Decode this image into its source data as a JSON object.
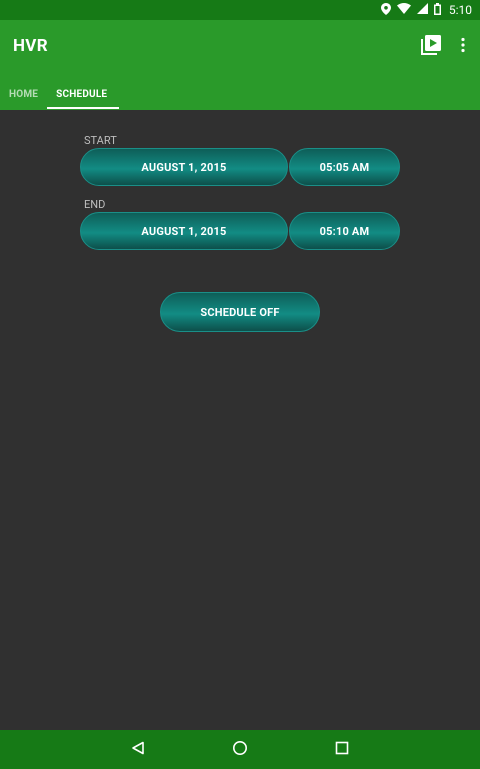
{
  "status_bar": {
    "time": "5:10",
    "icons": [
      "location-icon",
      "wifi-icon",
      "signal-icon",
      "battery-icon"
    ]
  },
  "app_bar": {
    "title": "HVR",
    "actions": [
      "video-library-icon",
      "overflow-menu-icon"
    ]
  },
  "tabs": [
    {
      "label": "HOME",
      "active": false
    },
    {
      "label": "SCHEDULE",
      "active": true
    }
  ],
  "schedule": {
    "start": {
      "label": "START",
      "date": "AUGUST 1, 2015",
      "time": "05:05 AM"
    },
    "end": {
      "label": "END",
      "date": "AUGUST 1, 2015",
      "time": "05:10 AM"
    },
    "toggle_label": "SCHEDULE OFF"
  },
  "nav_bar": {
    "buttons": [
      "back-icon",
      "home-icon",
      "recents-icon"
    ]
  },
  "colors": {
    "status_bar": "#167a16",
    "app_bar": "#2a9a2a",
    "background": "#303030",
    "button_teal": "#128c84"
  }
}
